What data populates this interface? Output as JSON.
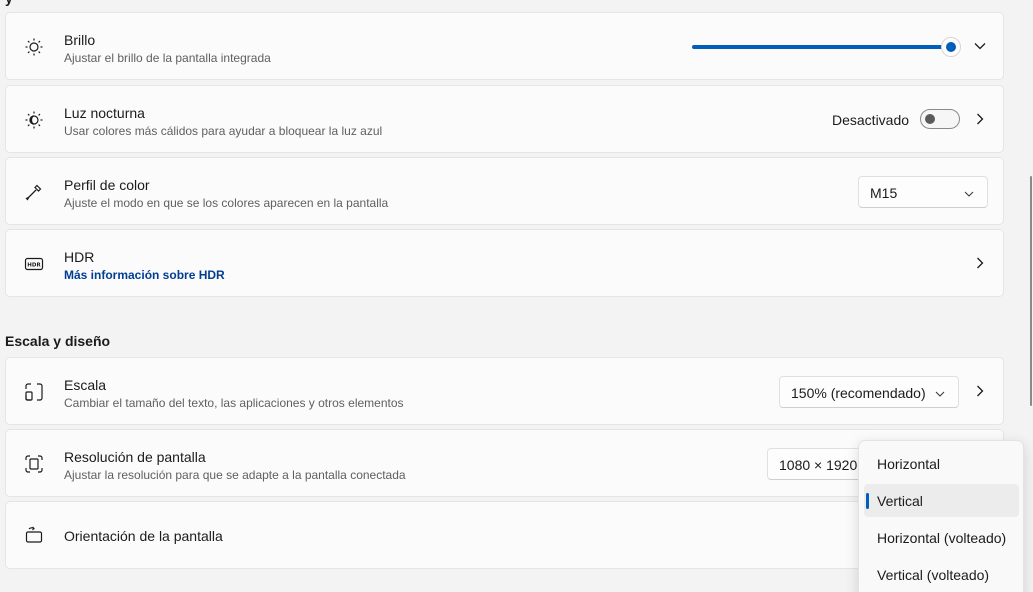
{
  "header_fragment": "y",
  "cards": {
    "brightness": {
      "title": "Brillo",
      "subtitle": "Ajustar el brillo de la pantalla integrada",
      "level_percent": 100
    },
    "night_light": {
      "title": "Luz nocturna",
      "subtitle": "Usar colores más cálidos para ayudar a bloquear la luz azul",
      "status": "Desactivado",
      "enabled": false
    },
    "color_profile": {
      "title": "Perfil de color",
      "subtitle": "Ajuste el modo en que se los colores aparecen en la pantalla",
      "selected": "M15"
    },
    "hdr": {
      "title": "HDR",
      "link": "Más información sobre HDR"
    },
    "scale": {
      "title": "Escala",
      "subtitle": "Cambiar el tamaño del texto, las aplicaciones y otros elementos",
      "selected": "150% (recomendado)"
    },
    "resolution": {
      "title": "Resolución de pantalla",
      "subtitle": "Ajustar la resolución para que se adapte a la pantalla conectada",
      "selected": "1080 × 1920 ("
    },
    "orientation": {
      "title": "Orientación de la pantalla"
    }
  },
  "section_scale": "Escala y diseño",
  "orientation_menu": {
    "options": [
      "Horizontal",
      "Vertical",
      "Horizontal (volteado)",
      "Vertical (volteado)"
    ],
    "selected": "Vertical"
  },
  "colors": {
    "accent": "#005fb8",
    "link": "#003e92",
    "background": "#f3f3f3",
    "card": "#fbfbfb"
  },
  "icons": {
    "brightness": "sun-icon",
    "night_light": "night-light-icon",
    "color_profile": "eyedropper-icon",
    "hdr": "hdr-icon",
    "scale": "scale-icon",
    "resolution": "resolution-icon",
    "orientation": "orientation-icon"
  }
}
